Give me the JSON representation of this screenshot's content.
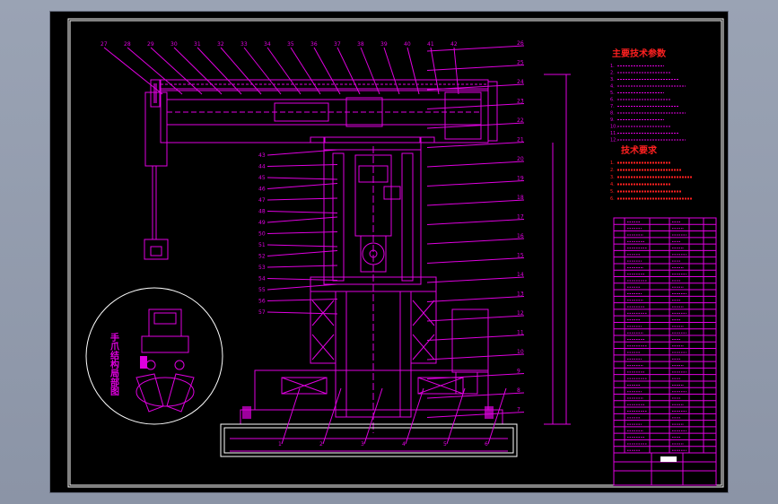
{
  "diagram": {
    "params_title": "主要技术参数",
    "params_lines": [
      "1.",
      "2.",
      "3.",
      "4.",
      "5.",
      "6.",
      "7.",
      "8.",
      "9.",
      "10.",
      "11.",
      "12."
    ],
    "reqs_title": "技术要求",
    "reqs_lines": [
      "1.",
      "2.",
      "3.",
      "4.",
      "5.",
      "6."
    ],
    "detail_label": "手爪结构局部图",
    "callouts_top": [
      "27",
      "28",
      "29",
      "30",
      "31",
      "32",
      "33",
      "34",
      "35",
      "36",
      "37",
      "38",
      "39",
      "40",
      "41",
      "42"
    ],
    "callouts_left": [
      "43",
      "44",
      "45",
      "46",
      "47",
      "48",
      "49",
      "50",
      "51",
      "52",
      "53",
      "54",
      "55",
      "56",
      "57"
    ],
    "callouts_right": [
      "26",
      "25",
      "24",
      "23",
      "22",
      "21",
      "20",
      "19",
      "18",
      "17",
      "16",
      "15",
      "14",
      "13",
      "12",
      "11",
      "10",
      "9",
      "8",
      "7"
    ],
    "callouts_bottom": [
      "1",
      "2",
      "3",
      "4",
      "5",
      "6"
    ],
    "colors": {
      "lines": "#e000e0",
      "outline": "#ffffff",
      "requirements": "#ff2020",
      "background": "#000000"
    }
  }
}
